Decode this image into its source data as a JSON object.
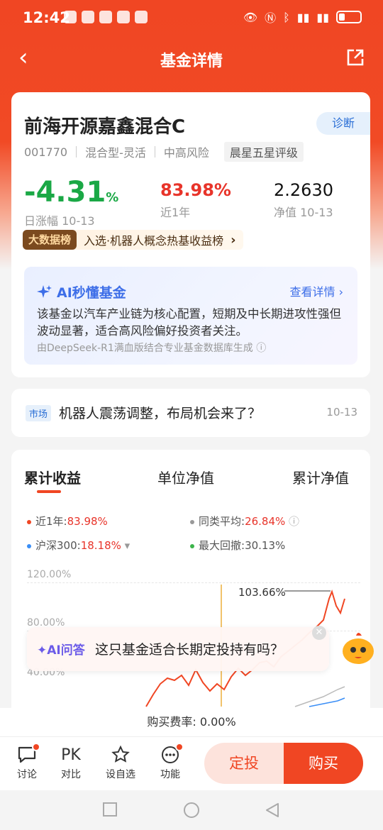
{
  "status_bar": {
    "time": "12:42"
  },
  "nav": {
    "title": "基金详情"
  },
  "fund": {
    "name": "前海开源嘉鑫混合C",
    "diagnose_label": "诊断",
    "code": "001770",
    "type": "混合型-灵活",
    "risk": "中高风险",
    "rating": "晨星五星评级",
    "daily_change": "-4.31",
    "daily_change_unit": "%",
    "daily_change_label": "日涨幅 10-13",
    "year_return": "83.98%",
    "year_return_label": "近1年",
    "nav_value": "2.2630",
    "nav_label": "净值 10-13",
    "rank_badge": "大数据榜",
    "rank_text": "入选·机器人概念热基收益榜"
  },
  "ai_summary": {
    "title": "AI秒懂基金",
    "more": "查看详情",
    "text": "该基金以汽车产业链为核心配置，短期及中长期进攻性强但波动显著，适合高风险偏好投资者关注。",
    "source": "由DeepSeek-R1满血版结合专业基金数据库生成"
  },
  "news": {
    "tag": "市场",
    "text": "机器人震荡调整，布局机会来了？",
    "date": "10-13"
  },
  "chart_section": {
    "tabs": [
      "累计收益",
      "单位净值",
      "累计净值"
    ],
    "legend": {
      "fund_label": "近1年:",
      "fund_value": "83.98%",
      "peer_label": "同类平均:",
      "peer_value": "26.84%",
      "index_label": "沪深300:",
      "index_value": "18.18%",
      "drawdown_label": "最大回撤:",
      "drawdown_value": "30.13%"
    },
    "peak_label": "103.66%",
    "y_ticks": [
      "120.00%",
      "80.00%",
      "40.00%"
    ]
  },
  "ai_ask": {
    "label": "AI问答",
    "question": "这只基金适合长期定投持有吗？"
  },
  "fee": {
    "text": "购买费率: 0.00%"
  },
  "bottom": {
    "discuss": "讨论",
    "compare_icon": "PK",
    "compare": "对比",
    "watch": "设自选",
    "func": "功能",
    "dingtou": "定投",
    "buy": "购买"
  },
  "colors": {
    "accent": "#f04623",
    "up": "#e8342a",
    "down": "#1aa845",
    "link": "#2b6fd6"
  }
}
